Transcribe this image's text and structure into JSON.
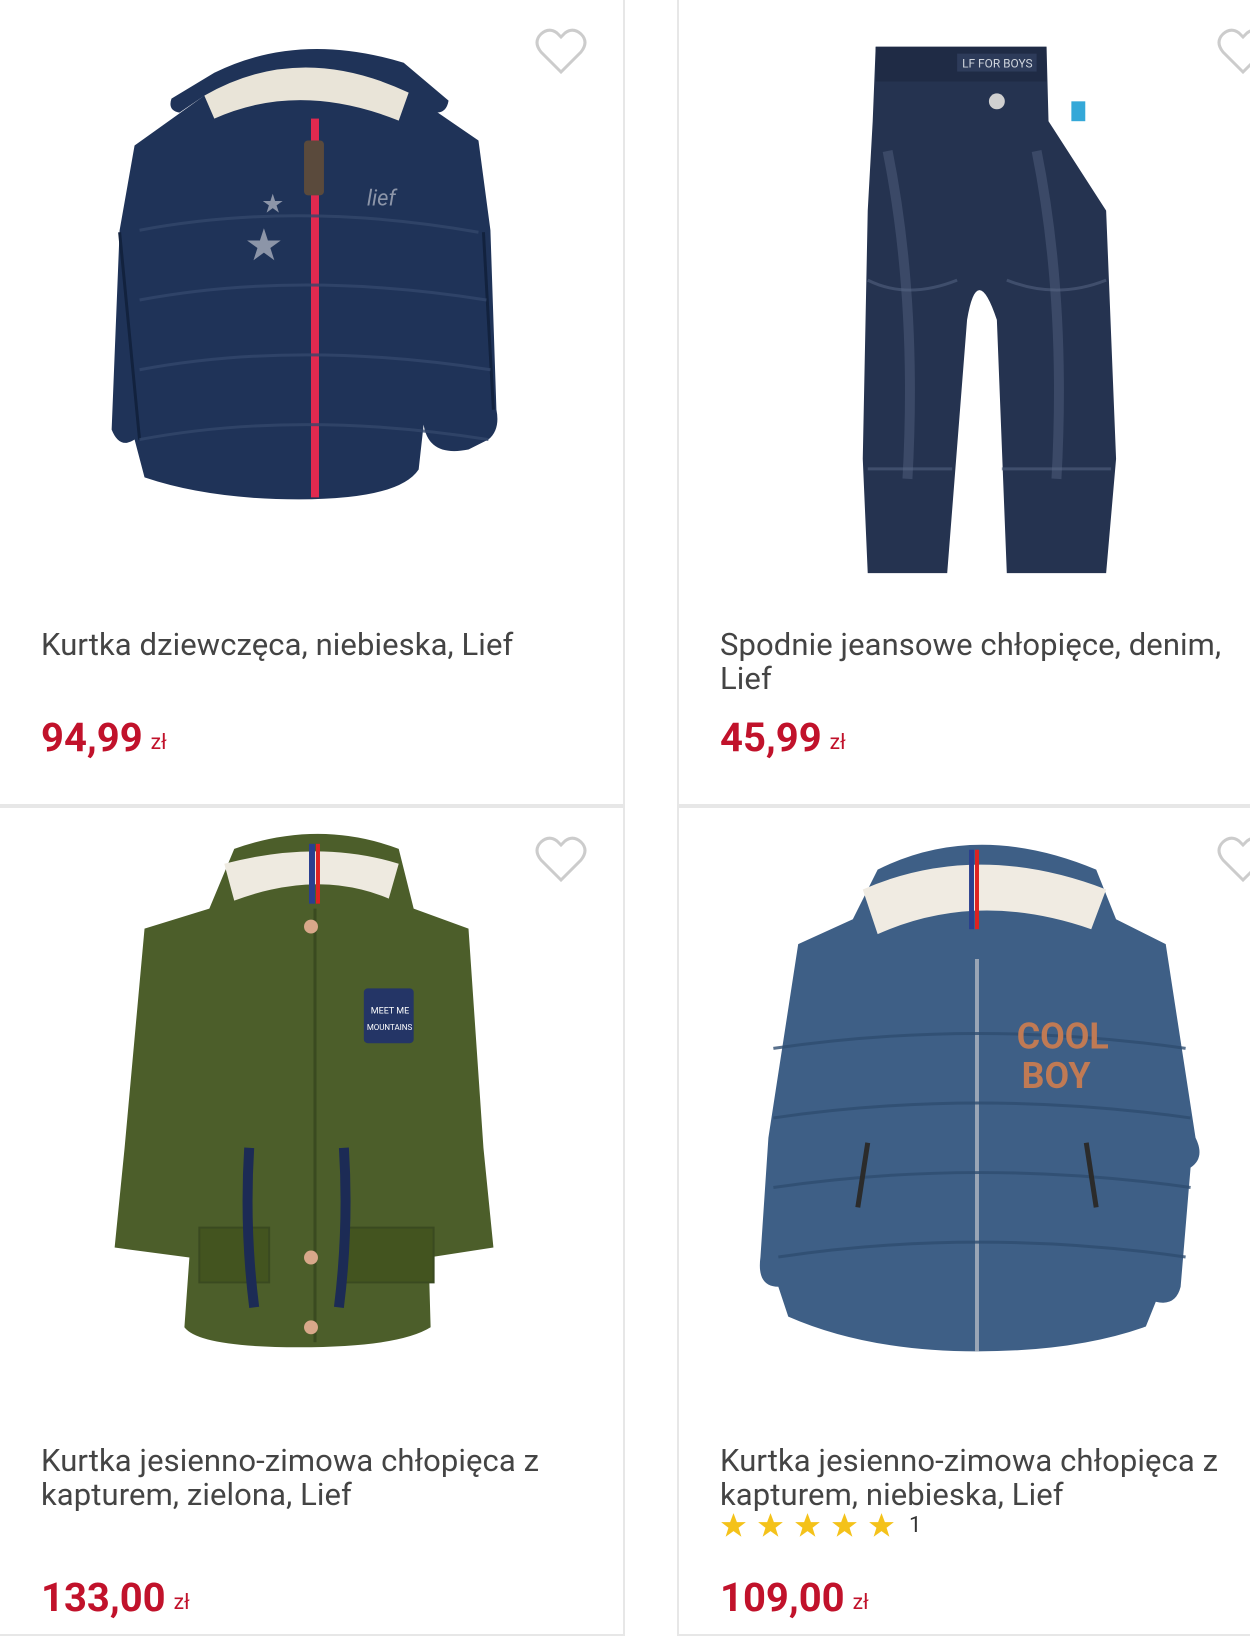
{
  "products": [
    {
      "name": "Kurtka dziewczęca, niebieska, Lief",
      "price": "94,99",
      "currency": "zł",
      "image": "navy-girls-jacket-with-pink-zipper"
    },
    {
      "name": "Spodnie jeansowe chłopięce, denim, Lief",
      "price": "45,99",
      "currency": "zł",
      "image": "dark-denim-jeans"
    },
    {
      "name": "Kurtka jesienno-zimowa chłopięca z kapturem, zielona, Lief",
      "price": "133,00",
      "currency": "zł",
      "image": "green-parka-with-hood"
    },
    {
      "name": "Kurtka jesienno-zimowa chłopięca z kapturem, niebieska, Lief",
      "price": "109,00",
      "currency": "zł",
      "rating": 5,
      "review_count": "1",
      "image": "blue-puffer-jacket-cool-boy"
    }
  ],
  "colors": {
    "price": "#c1122b",
    "star": "#f4c21a",
    "heart": "#cccccc",
    "border": "#e7e7e7"
  }
}
